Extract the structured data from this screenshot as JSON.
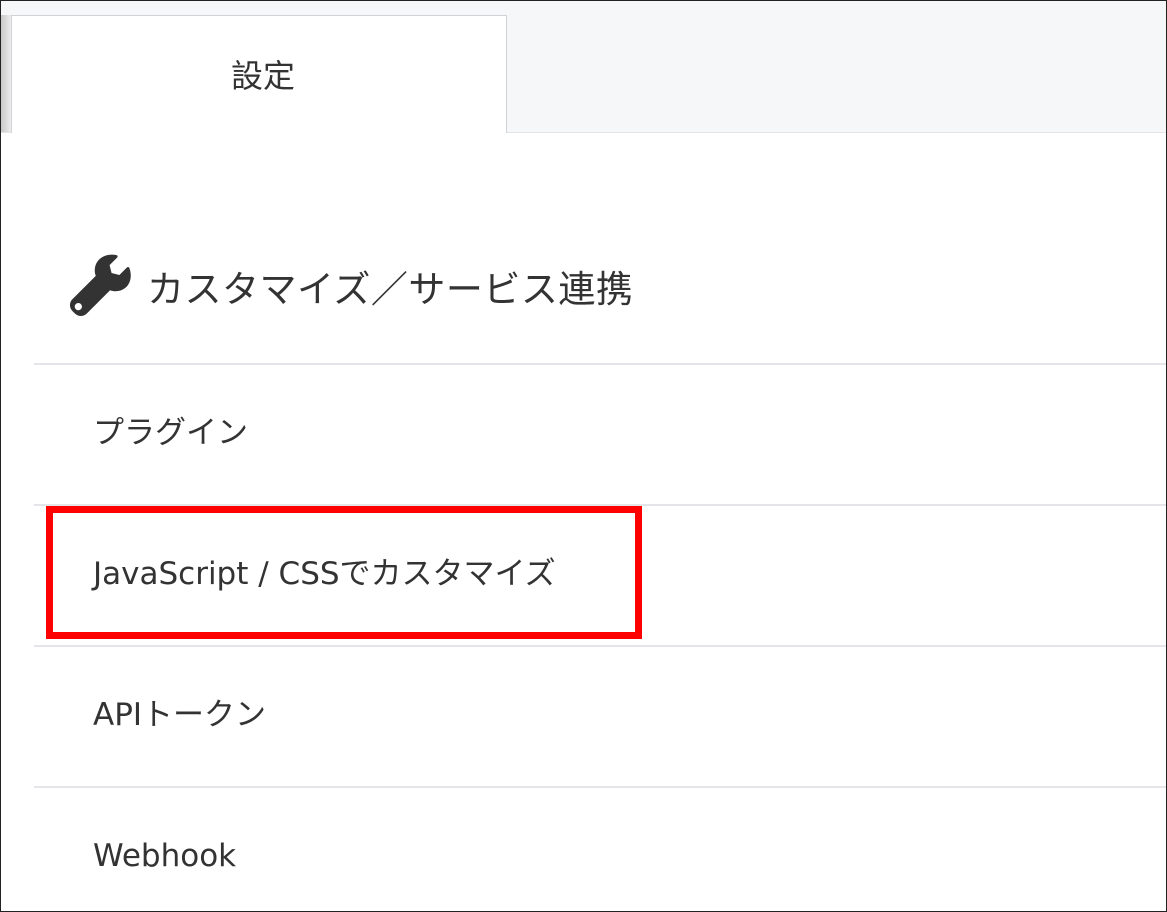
{
  "tabs": [
    {
      "label": "設定"
    }
  ],
  "section": {
    "icon": "wrench-icon",
    "title": "カスタマイズ／サービス連携"
  },
  "menu": {
    "items": [
      {
        "label": "プラグイン"
      },
      {
        "label": "JavaScript / CSSでカスタマイズ"
      },
      {
        "label": "APIトークン"
      },
      {
        "label": "Webhook"
      }
    ]
  },
  "highlight": {
    "color": "#ff0000",
    "target": "JavaScript / CSSでカスタマイズ"
  }
}
